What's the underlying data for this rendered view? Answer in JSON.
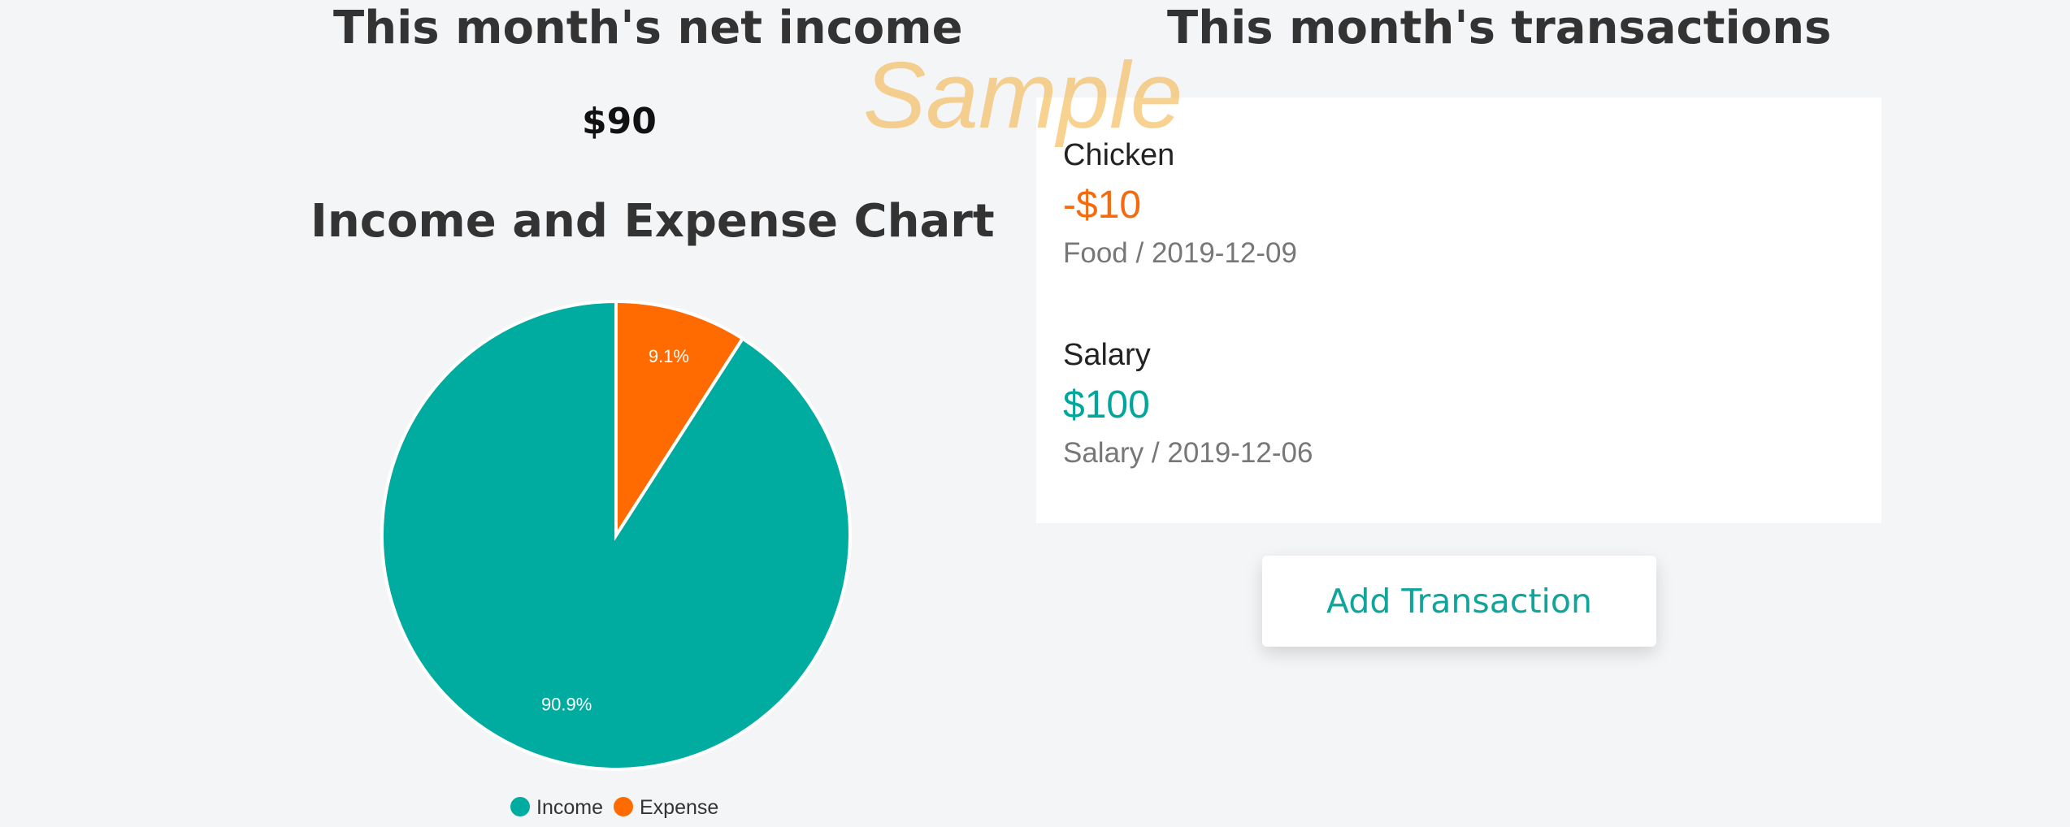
{
  "net_income": {
    "title": "This month's net income",
    "amount": "$90"
  },
  "chart_section": {
    "title": "Income and Expense Chart"
  },
  "chart_data": {
    "type": "pie",
    "title": "Income and Expense Chart",
    "labels": [
      "Income",
      "Expense"
    ],
    "values": [
      100,
      10
    ],
    "percent_labels": [
      "90.9%",
      "9.1%"
    ],
    "colors": [
      "#00ab9f",
      "#ff6b00"
    ],
    "legend": "bottom"
  },
  "transactions": {
    "title": "This month's transactions",
    "items": [
      {
        "name": "Chicken",
        "amount": "-$10",
        "meta": "Food / 2019-12-09",
        "amount_color": "#f46a0d"
      },
      {
        "name": "Salary",
        "amount": "$100",
        "meta": "Salary / 2019-12-06",
        "amount_color": "#00a69b"
      }
    ]
  },
  "add_button": {
    "label": "Add Transaction"
  },
  "watermark": {
    "text": "Sample"
  }
}
